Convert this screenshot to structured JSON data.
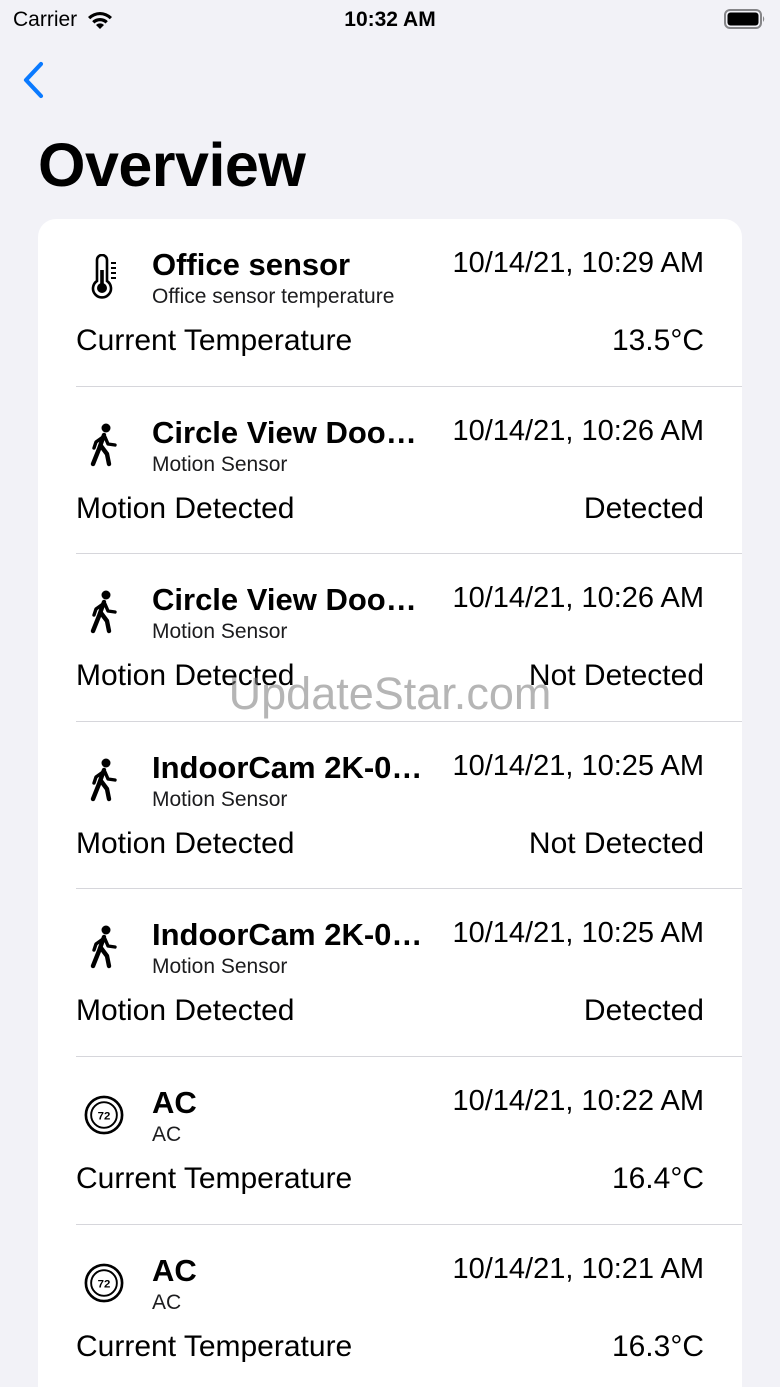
{
  "status_bar": {
    "carrier": "Carrier",
    "time": "10:32 AM"
  },
  "nav": {
    "back_icon": "chevron-left-icon",
    "title": "Overview"
  },
  "accent_color": "#0a7aff",
  "rows": [
    {
      "icon": "thermometer-icon",
      "name": "Office sensor",
      "subtitle": "Office sensor temperature",
      "time": "10/14/21, 10:29 AM",
      "label": "Current Temperature",
      "value": "13.5°C"
    },
    {
      "icon": "walking-person-icon",
      "name": "Circle View Door…",
      "subtitle": "Motion Sensor",
      "time": "10/14/21, 10:26 AM",
      "label": "Motion Detected",
      "value": "Detected"
    },
    {
      "icon": "walking-person-icon",
      "name": "Circle View Door…",
      "subtitle": "Motion Sensor",
      "time": "10/14/21, 10:26 AM",
      "label": "Motion Detected",
      "value": "Not Detected"
    },
    {
      "icon": "walking-person-icon",
      "name": "IndoorCam 2K-0…",
      "subtitle": "Motion Sensor",
      "time": "10/14/21, 10:25 AM",
      "label": "Motion Detected",
      "value": "Not Detected"
    },
    {
      "icon": "walking-person-icon",
      "name": "IndoorCam 2K-0…",
      "subtitle": "Motion Sensor",
      "time": "10/14/21, 10:25 AM",
      "label": "Motion Detected",
      "value": "Detected"
    },
    {
      "icon": "thermostat-icon",
      "name": "AC",
      "subtitle": "AC",
      "time": "10/14/21, 10:22 AM",
      "label": "Current Temperature",
      "value": "16.4°C",
      "thermostat_text": "72"
    },
    {
      "icon": "thermostat-icon",
      "name": "AC",
      "subtitle": "AC",
      "time": "10/14/21, 10:21 AM",
      "label": "Current Temperature",
      "value": "16.3°C",
      "thermostat_text": "72"
    }
  ],
  "watermark": "UpdateStar.com"
}
